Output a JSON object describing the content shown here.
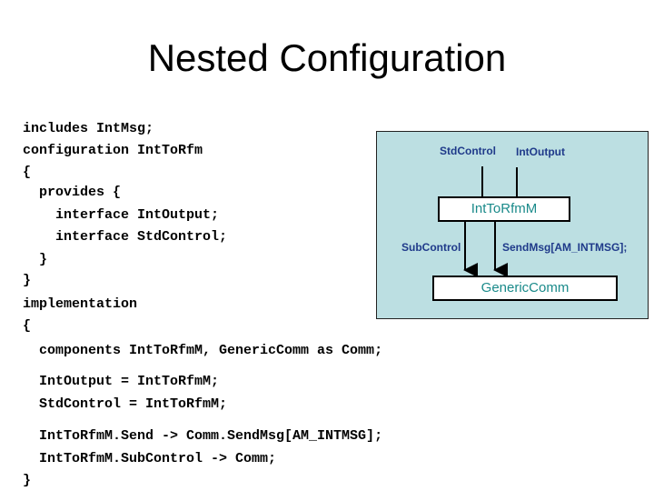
{
  "title": "Nested Configuration",
  "code": {
    "lines": [
      "includes IntMsg;",
      "configuration IntToRfm",
      "{",
      "  provides {",
      "    interface IntOutput;",
      "    interface StdControl;",
      "  }",
      "}",
      "implementation",
      "{",
      "  components IntToRfmM, GenericComm as Comm;",
      "  IntOutput = IntToRfmM;",
      "  StdControl = IntToRfmM;",
      "  IntToRfmM.Send -> Comm.SendMsg[AM_INTMSG];",
      "  IntToRfmM.SubControl -> Comm;",
      "}"
    ]
  },
  "diagram": {
    "top_labels": [
      "StdControl",
      "IntOutput"
    ],
    "module_box": "IntToRfmM",
    "wire_labels": [
      "SubControl",
      "SendMsg[AM_INTMSG];"
    ],
    "component_box": "GenericComm",
    "colors": {
      "panel": "#bcdfe2",
      "label": "#1f3a8a",
      "box_text": "#1a8a8a"
    }
  }
}
